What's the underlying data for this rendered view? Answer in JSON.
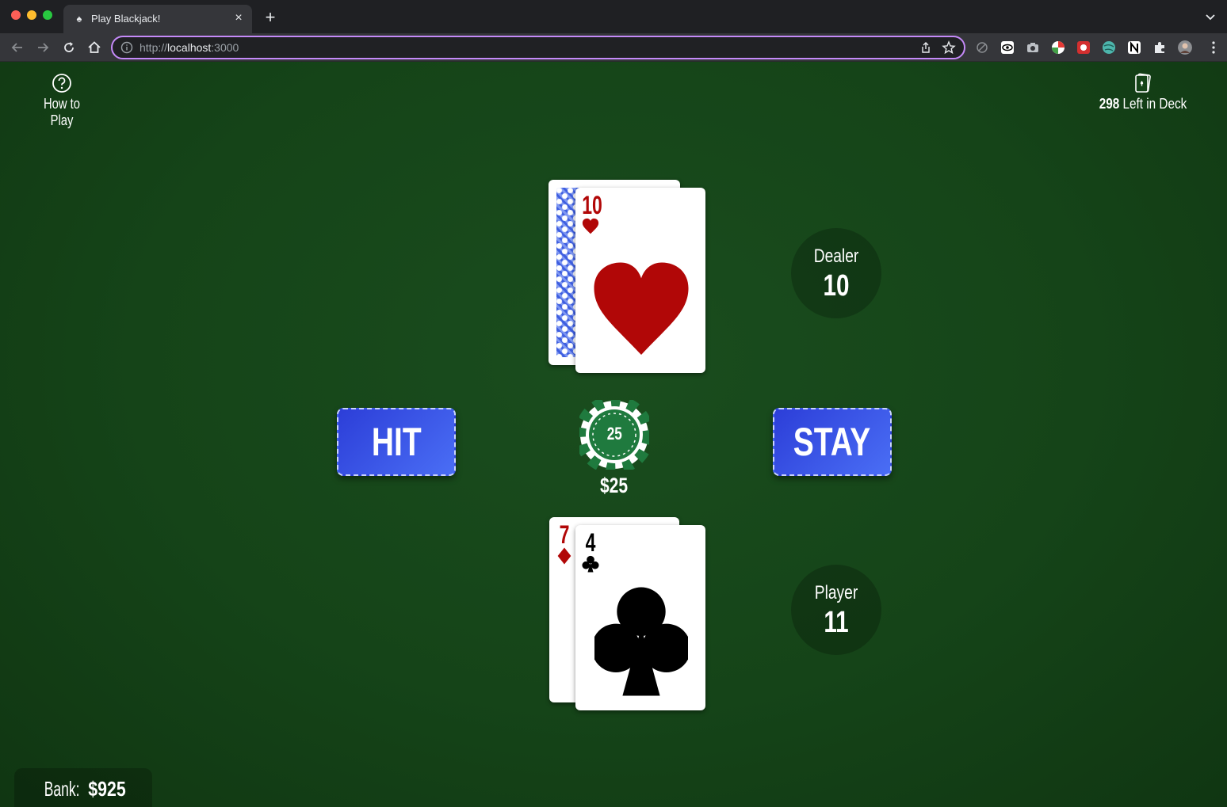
{
  "browser": {
    "tab_title": "Play Blackjack!",
    "url_scheme": "http://",
    "url_host": "localhost",
    "url_port": ":3000"
  },
  "game": {
    "help_label": "How to Play",
    "deck_count": "298",
    "deck_suffix": "Left in Deck",
    "dealer": {
      "label": "Dealer",
      "score": "10",
      "cards": [
        {
          "face": "down"
        },
        {
          "face": "up",
          "rank": "10",
          "suit": "hearts",
          "color": "#b10707"
        }
      ]
    },
    "player": {
      "label": "Player",
      "score": "11",
      "cards": [
        {
          "face": "up",
          "rank": "7",
          "suit": "diamonds",
          "color": "#b10707"
        },
        {
          "face": "up",
          "rank": "4",
          "suit": "clubs",
          "color": "#000000"
        }
      ]
    },
    "hit_label": "HIT",
    "stay_label": "STAY",
    "chip_value": "25",
    "bet_amount": "$25",
    "bank_label": "Bank:",
    "bank_amount": "$925",
    "colors": {
      "felt": "#154418",
      "button": "#3b55e6",
      "chip": "#1f7a3e",
      "suit_red": "#b10707"
    }
  }
}
